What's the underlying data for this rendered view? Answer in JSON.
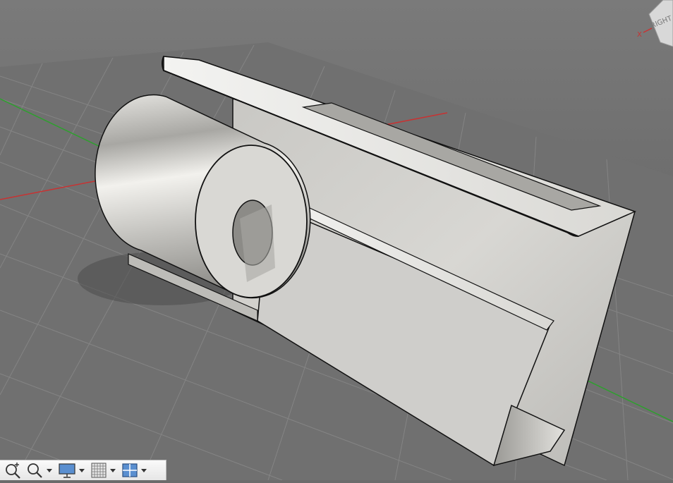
{
  "viewcube": {
    "face_label": "RIGHT",
    "axis_label": "X"
  },
  "colors": {
    "background": "#6b6b6b",
    "grid": "#808080",
    "axis_x": "#c83232",
    "axis_y": "#2da02d",
    "part_face": "#d7d6d2",
    "edge": "#111111"
  },
  "toolbar": {
    "items": [
      {
        "name": "zoom-window-icon",
        "has_dropdown": false
      },
      {
        "name": "zoom-icon",
        "has_dropdown": true
      },
      {
        "name": "display-settings-icon",
        "has_dropdown": true
      },
      {
        "name": "grid-settings-icon",
        "has_dropdown": true
      },
      {
        "name": "viewports-icon",
        "has_dropdown": true
      }
    ]
  }
}
